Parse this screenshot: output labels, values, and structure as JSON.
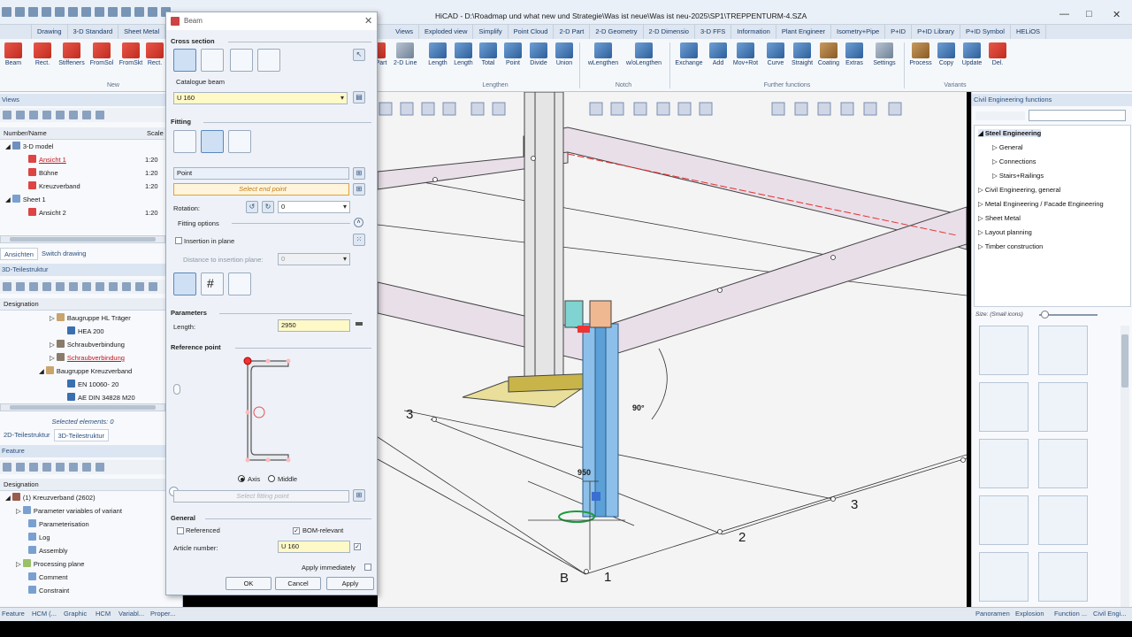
{
  "window": {
    "title": "HiCAD - D:\\Roadmap und what new und Strategie\\Was ist neue\\Was ist neu-2025\\SP1\\TREPPENTURM-4.SZA"
  },
  "menu_tabs": [
    "Drawing",
    "3-D Standard",
    "Sheet Metal",
    "Views",
    "Exploded view",
    "Simplify",
    "Point Cloud",
    "2-D Part",
    "2-D Geometry",
    "2-D Dimensio",
    "3-D FFS",
    "Information",
    "Plant Engineer",
    "Isometry+Pipe",
    "P+ID",
    "P+ID Library",
    "P+ID Symbol",
    "HELiOS"
  ],
  "ribbon": {
    "left_buttons": [
      "Beam",
      "Rect.",
      "Stiffeners",
      "FromSol",
      "FromSkt",
      "Rect."
    ],
    "left_group": "New",
    "lengthen_buttons": [
      "Part",
      "2-D Line",
      "Length",
      "Length",
      "Total",
      "Point",
      "Divide",
      "Union"
    ],
    "lengthen_group": "Lengthen",
    "notch_buttons": [
      "wLengthen",
      "w/oLengthen"
    ],
    "notch_group": "Notch",
    "further_buttons": [
      "Exchange",
      "Add",
      "Mov+Rot",
      "Curve",
      "Straight",
      "Coating",
      "Extras",
      "Settings"
    ],
    "further_group": "Further functions",
    "variant_buttons": [
      "Process",
      "Copy",
      "Update",
      "Del."
    ],
    "variant_group": "Variants"
  },
  "left_panel": {
    "views_title": "Views",
    "col_name": "Number/Name",
    "col_scale": "Scale",
    "views_rows": [
      {
        "name": "3-D model",
        "scale": ""
      },
      {
        "name": "Ansicht 1",
        "scale": "1:20"
      },
      {
        "name": "Bühne",
        "scale": "1:20"
      },
      {
        "name": "Kreuzverband",
        "scale": "1:20"
      },
      {
        "name": "Sheet 1",
        "scale": ""
      },
      {
        "name": "Ansicht 2",
        "scale": "1:20"
      }
    ],
    "views_tabs": [
      "Ansichten",
      "Switch drawing"
    ],
    "struct_title": "3D-Teilestruktur",
    "designation": "Designation",
    "struct_rows": [
      "Baugruppe HL Träger",
      "HEA 200",
      "Schraubverbindung",
      "Schraubverbindung",
      "Baugruppe Kreuzverband",
      "EN 10060- 20",
      "AE DIN 34828 M20"
    ],
    "selected": "Selected elements: 0",
    "struct_tabs": [
      "2D-Teilestruktur",
      "3D-Teilestruktur"
    ],
    "feature_title": "Feature",
    "feature_rows": [
      "(1) Kreuzverband (2602)",
      "Parameter variables of variant",
      "Parameterisation",
      "Log",
      "Assembly",
      "Processing plane",
      "Comment",
      "Constraint"
    ]
  },
  "dialog": {
    "title": "Beam",
    "cross_section": "Cross section",
    "catalogue_label": "Catalogue beam",
    "catalogue_value": "U 160",
    "fitting": "Fitting",
    "point_field": "Point",
    "select_end": "Select end point",
    "rotation_label": "Rotation:",
    "rotation_value": "0",
    "fitting_options": "Fitting options",
    "insertion_label": "Insertion in plane",
    "distance_label": "Distance to insertion plane:",
    "distance_value": "0",
    "parameters": "Parameters",
    "length_label": "Length:",
    "length_value": "2950",
    "reference_point": "Reference point",
    "axis_label": "Axis",
    "middle_label": "Middle",
    "select_fitting": "Select fitting point",
    "general": "General",
    "referenced": "Referenced",
    "bom": "BOM-relevant",
    "article_label": "Article number:",
    "article_value": "U 160",
    "apply_immediately": "Apply immediately",
    "ok": "OK",
    "cancel": "Cancel",
    "apply": "Apply"
  },
  "viewport": {
    "labels": {
      "a": "3",
      "b": "3",
      "c": "2",
      "d": "1",
      "e": "B",
      "angle": "90°",
      "dim": "950"
    }
  },
  "right_panel": {
    "title": "Civil Engineering functions",
    "tree": [
      {
        "label": "Steel Engineering",
        "bold": true,
        "level": 0
      },
      {
        "label": "General",
        "level": 1
      },
      {
        "label": "Connections",
        "level": 1
      },
      {
        "label": "Stairs+Railings",
        "level": 1
      },
      {
        "label": "Civil Engineering, general",
        "level": 0
      },
      {
        "label": "Metal Engineering / Facade Engineering",
        "level": 0
      },
      {
        "label": "Sheet Metal",
        "level": 0
      },
      {
        "label": "Layout planning",
        "level": 0
      },
      {
        "label": "Timber construction",
        "level": 0
      }
    ],
    "size_label": "Size:",
    "size_value": "(Small icons)"
  },
  "bottom_tabs": [
    "Feature",
    "HCM (...",
    "Graphic",
    "HCM",
    "Variabl...",
    "Proper...",
    "Panoramen",
    "Explosion",
    "Function ...",
    "Civil Engi..."
  ]
}
